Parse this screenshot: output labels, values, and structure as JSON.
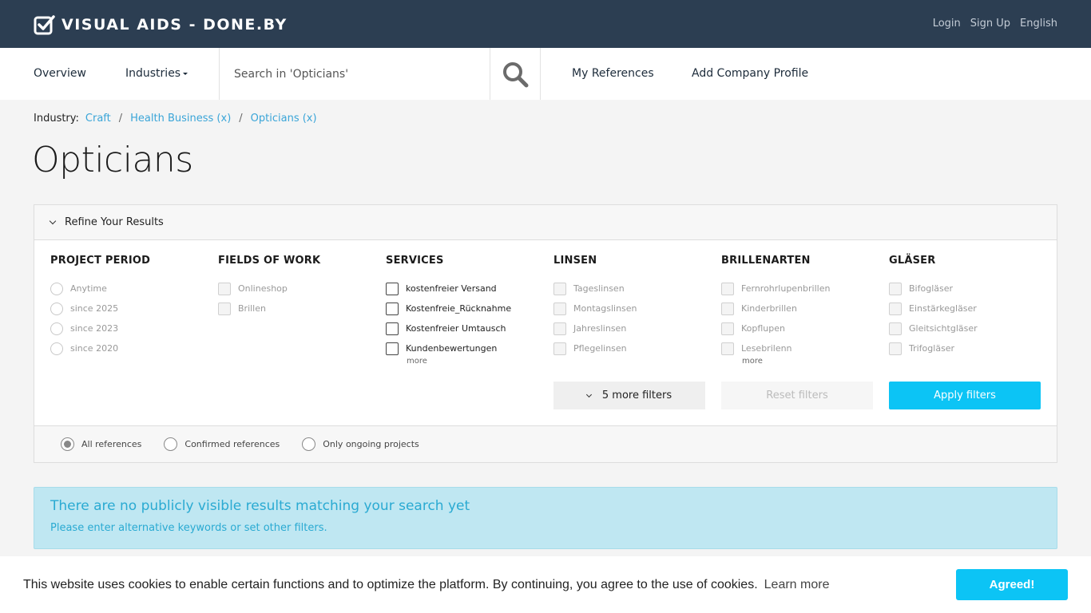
{
  "brand": {
    "name": "VISUAL AIDS - DONE.BY",
    "logo_icon": "checkbox-check-icon"
  },
  "top_links": {
    "login": "Login",
    "signup": "Sign Up",
    "language": "English"
  },
  "nav": {
    "overview": "Overview",
    "industries": "Industries",
    "search_placeholder": "Search in 'Opticians'",
    "search_icon": "search-icon",
    "my_references": "My References",
    "add_company": "Add Company Profile"
  },
  "breadcrumb": {
    "label": "Industry:",
    "items": [
      "Craft",
      "Health Business (x)",
      "Opticians (x)"
    ],
    "separator": "/"
  },
  "page": {
    "title": "Opticians"
  },
  "filters": {
    "header": "Refine Your Results",
    "columns": [
      {
        "title": "PROJECT PERIOD",
        "type": "radio",
        "options": [
          "Anytime",
          "since 2025",
          "since 2023",
          "since 2020"
        ]
      },
      {
        "title": "FIELDS OF WORK",
        "type": "checkbox",
        "options": [
          "Onlineshop",
          "Brillen"
        ]
      },
      {
        "title": "SERVICES",
        "type": "checkbox",
        "options": [
          "kostenfreier Versand",
          "Kostenfreie_Rücknahme",
          "Kostenfreier Umtausch",
          "Kundenbewertungen"
        ],
        "more": "more"
      },
      {
        "title": "LINSEN",
        "type": "checkbox",
        "options": [
          "Tageslinsen",
          "Montagslinsen",
          "Jahreslinsen",
          "Pflegelinsen"
        ]
      },
      {
        "title": "BRILLENARTEN",
        "type": "checkbox",
        "options": [
          "Fernrohrlupenbrillen",
          "Kinderbrillen",
          "Kopflupen",
          "Lesebrilenn"
        ],
        "more": "more"
      },
      {
        "title": "GLÄSER",
        "type": "checkbox",
        "options": [
          "Bifogläser",
          "Einstärkegläser",
          "Gleitsichtgläser",
          "Trifogläser"
        ]
      }
    ],
    "more_filters": "5 more filters",
    "reset": "Reset filters",
    "apply": "Apply filters",
    "reference_options": [
      "All references",
      "Confirmed references",
      "Only ongoing projects"
    ],
    "selected_reference": "All references"
  },
  "alert": {
    "title": "There are no publicly visible results matching your search yet",
    "text": "Please enter alternative keywords or set other filters."
  },
  "cookie": {
    "text": "This website uses cookies to enable certain functions and to optimize the platform. By continuing, you agree to the use of cookies.",
    "link": "Learn more",
    "button": "Agreed!"
  },
  "colors": {
    "topbar": "#2c3e52",
    "accent": "#0cc4f5",
    "link": "#3aa5d8",
    "alert_bg": "#bfe7f2"
  }
}
